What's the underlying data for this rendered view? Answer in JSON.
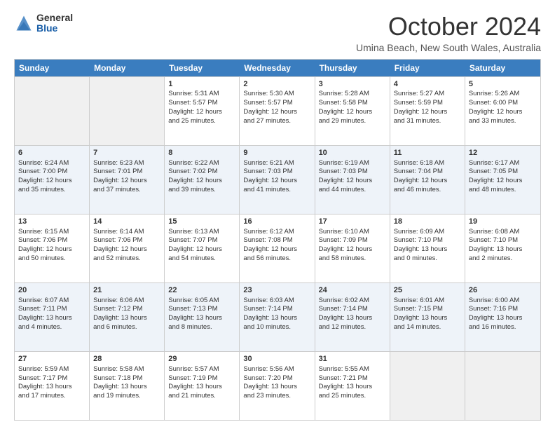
{
  "logo": {
    "general": "General",
    "blue": "Blue"
  },
  "title": "October 2024",
  "subtitle": "Umina Beach, New South Wales, Australia",
  "days": [
    "Sunday",
    "Monday",
    "Tuesday",
    "Wednesday",
    "Thursday",
    "Friday",
    "Saturday"
  ],
  "weeks": [
    [
      {
        "day": "",
        "empty": true
      },
      {
        "day": "",
        "empty": true
      },
      {
        "day": "1",
        "line1": "Sunrise: 5:31 AM",
        "line2": "Sunset: 5:57 PM",
        "line3": "Daylight: 12 hours",
        "line4": "and 25 minutes."
      },
      {
        "day": "2",
        "line1": "Sunrise: 5:30 AM",
        "line2": "Sunset: 5:57 PM",
        "line3": "Daylight: 12 hours",
        "line4": "and 27 minutes."
      },
      {
        "day": "3",
        "line1": "Sunrise: 5:28 AM",
        "line2": "Sunset: 5:58 PM",
        "line3": "Daylight: 12 hours",
        "line4": "and 29 minutes."
      },
      {
        "day": "4",
        "line1": "Sunrise: 5:27 AM",
        "line2": "Sunset: 5:59 PM",
        "line3": "Daylight: 12 hours",
        "line4": "and 31 minutes."
      },
      {
        "day": "5",
        "line1": "Sunrise: 5:26 AM",
        "line2": "Sunset: 6:00 PM",
        "line3": "Daylight: 12 hours",
        "line4": "and 33 minutes."
      }
    ],
    [
      {
        "day": "6",
        "line1": "Sunrise: 6:24 AM",
        "line2": "Sunset: 7:00 PM",
        "line3": "Daylight: 12 hours",
        "line4": "and 35 minutes."
      },
      {
        "day": "7",
        "line1": "Sunrise: 6:23 AM",
        "line2": "Sunset: 7:01 PM",
        "line3": "Daylight: 12 hours",
        "line4": "and 37 minutes."
      },
      {
        "day": "8",
        "line1": "Sunrise: 6:22 AM",
        "line2": "Sunset: 7:02 PM",
        "line3": "Daylight: 12 hours",
        "line4": "and 39 minutes."
      },
      {
        "day": "9",
        "line1": "Sunrise: 6:21 AM",
        "line2": "Sunset: 7:03 PM",
        "line3": "Daylight: 12 hours",
        "line4": "and 41 minutes."
      },
      {
        "day": "10",
        "line1": "Sunrise: 6:19 AM",
        "line2": "Sunset: 7:03 PM",
        "line3": "Daylight: 12 hours",
        "line4": "and 44 minutes."
      },
      {
        "day": "11",
        "line1": "Sunrise: 6:18 AM",
        "line2": "Sunset: 7:04 PM",
        "line3": "Daylight: 12 hours",
        "line4": "and 46 minutes."
      },
      {
        "day": "12",
        "line1": "Sunrise: 6:17 AM",
        "line2": "Sunset: 7:05 PM",
        "line3": "Daylight: 12 hours",
        "line4": "and 48 minutes."
      }
    ],
    [
      {
        "day": "13",
        "line1": "Sunrise: 6:15 AM",
        "line2": "Sunset: 7:06 PM",
        "line3": "Daylight: 12 hours",
        "line4": "and 50 minutes."
      },
      {
        "day": "14",
        "line1": "Sunrise: 6:14 AM",
        "line2": "Sunset: 7:06 PM",
        "line3": "Daylight: 12 hours",
        "line4": "and 52 minutes."
      },
      {
        "day": "15",
        "line1": "Sunrise: 6:13 AM",
        "line2": "Sunset: 7:07 PM",
        "line3": "Daylight: 12 hours",
        "line4": "and 54 minutes."
      },
      {
        "day": "16",
        "line1": "Sunrise: 6:12 AM",
        "line2": "Sunset: 7:08 PM",
        "line3": "Daylight: 12 hours",
        "line4": "and 56 minutes."
      },
      {
        "day": "17",
        "line1": "Sunrise: 6:10 AM",
        "line2": "Sunset: 7:09 PM",
        "line3": "Daylight: 12 hours",
        "line4": "and 58 minutes."
      },
      {
        "day": "18",
        "line1": "Sunrise: 6:09 AM",
        "line2": "Sunset: 7:10 PM",
        "line3": "Daylight: 13 hours",
        "line4": "and 0 minutes."
      },
      {
        "day": "19",
        "line1": "Sunrise: 6:08 AM",
        "line2": "Sunset: 7:10 PM",
        "line3": "Daylight: 13 hours",
        "line4": "and 2 minutes."
      }
    ],
    [
      {
        "day": "20",
        "line1": "Sunrise: 6:07 AM",
        "line2": "Sunset: 7:11 PM",
        "line3": "Daylight: 13 hours",
        "line4": "and 4 minutes."
      },
      {
        "day": "21",
        "line1": "Sunrise: 6:06 AM",
        "line2": "Sunset: 7:12 PM",
        "line3": "Daylight: 13 hours",
        "line4": "and 6 minutes."
      },
      {
        "day": "22",
        "line1": "Sunrise: 6:05 AM",
        "line2": "Sunset: 7:13 PM",
        "line3": "Daylight: 13 hours",
        "line4": "and 8 minutes."
      },
      {
        "day": "23",
        "line1": "Sunrise: 6:03 AM",
        "line2": "Sunset: 7:14 PM",
        "line3": "Daylight: 13 hours",
        "line4": "and 10 minutes."
      },
      {
        "day": "24",
        "line1": "Sunrise: 6:02 AM",
        "line2": "Sunset: 7:14 PM",
        "line3": "Daylight: 13 hours",
        "line4": "and 12 minutes."
      },
      {
        "day": "25",
        "line1": "Sunrise: 6:01 AM",
        "line2": "Sunset: 7:15 PM",
        "line3": "Daylight: 13 hours",
        "line4": "and 14 minutes."
      },
      {
        "day": "26",
        "line1": "Sunrise: 6:00 AM",
        "line2": "Sunset: 7:16 PM",
        "line3": "Daylight: 13 hours",
        "line4": "and 16 minutes."
      }
    ],
    [
      {
        "day": "27",
        "line1": "Sunrise: 5:59 AM",
        "line2": "Sunset: 7:17 PM",
        "line3": "Daylight: 13 hours",
        "line4": "and 17 minutes."
      },
      {
        "day": "28",
        "line1": "Sunrise: 5:58 AM",
        "line2": "Sunset: 7:18 PM",
        "line3": "Daylight: 13 hours",
        "line4": "and 19 minutes."
      },
      {
        "day": "29",
        "line1": "Sunrise: 5:57 AM",
        "line2": "Sunset: 7:19 PM",
        "line3": "Daylight: 13 hours",
        "line4": "and 21 minutes."
      },
      {
        "day": "30",
        "line1": "Sunrise: 5:56 AM",
        "line2": "Sunset: 7:20 PM",
        "line3": "Daylight: 13 hours",
        "line4": "and 23 minutes."
      },
      {
        "day": "31",
        "line1": "Sunrise: 5:55 AM",
        "line2": "Sunset: 7:21 PM",
        "line3": "Daylight: 13 hours",
        "line4": "and 25 minutes."
      },
      {
        "day": "",
        "empty": true
      },
      {
        "day": "",
        "empty": true
      }
    ]
  ]
}
